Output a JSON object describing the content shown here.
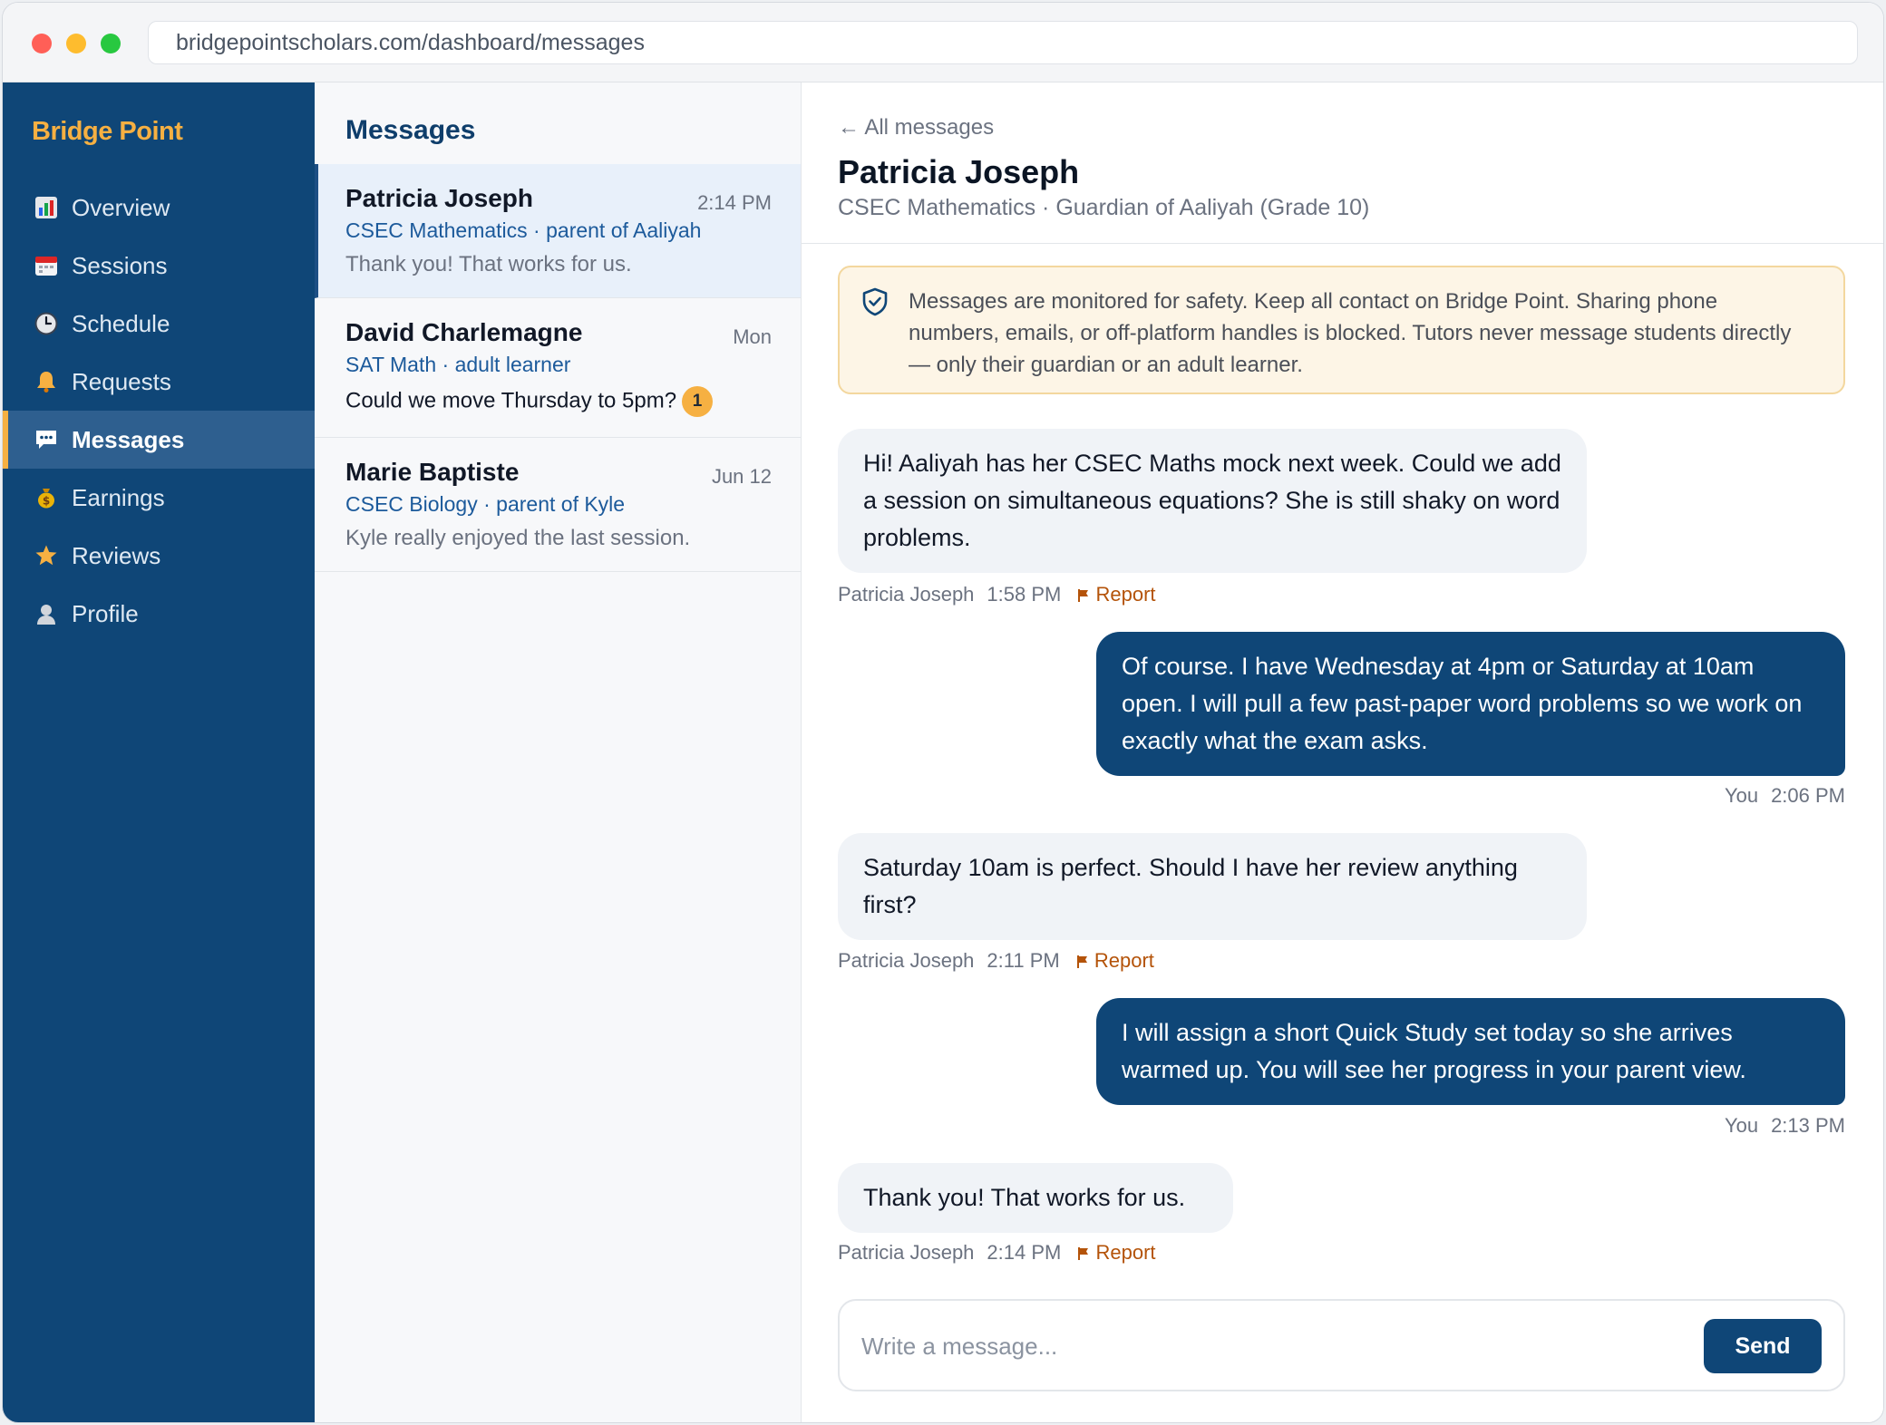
{
  "browser": {
    "url": "bridgepointscholars.com/dashboard/messages"
  },
  "sidebar": {
    "brand": "Bridge Point",
    "items": [
      {
        "label": "Overview",
        "icon": "bar-chart-icon",
        "active": false
      },
      {
        "label": "Sessions",
        "icon": "calendar-icon",
        "active": false
      },
      {
        "label": "Schedule",
        "icon": "clock-icon",
        "active": false
      },
      {
        "label": "Requests",
        "icon": "bell-icon",
        "active": false
      },
      {
        "label": "Messages",
        "icon": "chat-icon",
        "active": true
      },
      {
        "label": "Earnings",
        "icon": "money-bag-icon",
        "active": false
      },
      {
        "label": "Reviews",
        "icon": "star-icon",
        "active": false
      },
      {
        "label": "Profile",
        "icon": "user-icon",
        "active": false
      }
    ]
  },
  "list": {
    "title": "Messages",
    "threads": [
      {
        "name": "Patricia Joseph",
        "time": "2:14 PM",
        "subject": "CSEC Mathematics · parent of Aaliyah",
        "preview": "Thank you! That works for us.",
        "unread": ""
      },
      {
        "name": "David Charlemagne",
        "time": "Mon",
        "subject": "SAT Math · adult learner",
        "preview": "Could we move Thursday to 5pm?",
        "unread": "1"
      },
      {
        "name": "Marie Baptiste",
        "time": "Jun 12",
        "subject": "CSEC Biology · parent of Kyle",
        "preview": "Kyle really enjoyed the last session.",
        "unread": ""
      }
    ]
  },
  "conversation": {
    "back_label": "← All messages",
    "name": "Patricia Joseph",
    "subtitle": "CSEC Mathematics · Guardian of Aaliyah (Grade 10)",
    "safety_notice": "Messages are monitored for safety. Keep all contact on Bridge Point. Sharing phone numbers, emails, or off-platform handles is blocked. Tutors never message students directly — only their guardian or an adult learner.",
    "report_label": "Report",
    "messages": [
      {
        "direction": "in",
        "text": "Hi! Aaliyah has her CSEC Maths mock next week. Could we add a session on simultaneous equations? She is still shaky on word problems.",
        "sender": "Patricia Joseph",
        "time": "1:58 PM"
      },
      {
        "direction": "out",
        "text": "Of course. I have Wednesday at 4pm or Saturday at 10am open. I will pull a few past-paper word problems so we work on exactly what the exam asks.",
        "sender": "You",
        "time": "2:06 PM"
      },
      {
        "direction": "in",
        "text": "Saturday 10am is perfect. Should I have her review anything first?",
        "sender": "Patricia Joseph",
        "time": "2:11 PM"
      },
      {
        "direction": "out",
        "text": "I will assign a short Quick Study set today so she arrives warmed up. You will see her progress in your parent view.",
        "sender": "You",
        "time": "2:13 PM"
      },
      {
        "direction": "in",
        "text": "Thank you! That works for us.",
        "sender": "Patricia Joseph",
        "time": "2:14 PM"
      }
    ],
    "composer": {
      "placeholder": "Write a message...",
      "send_label": "Send"
    }
  },
  "colors": {
    "sidebar": "#0f4677",
    "accent": "#f6b042",
    "report": "#b45309",
    "outgoing_bubble": "#0f4677"
  }
}
